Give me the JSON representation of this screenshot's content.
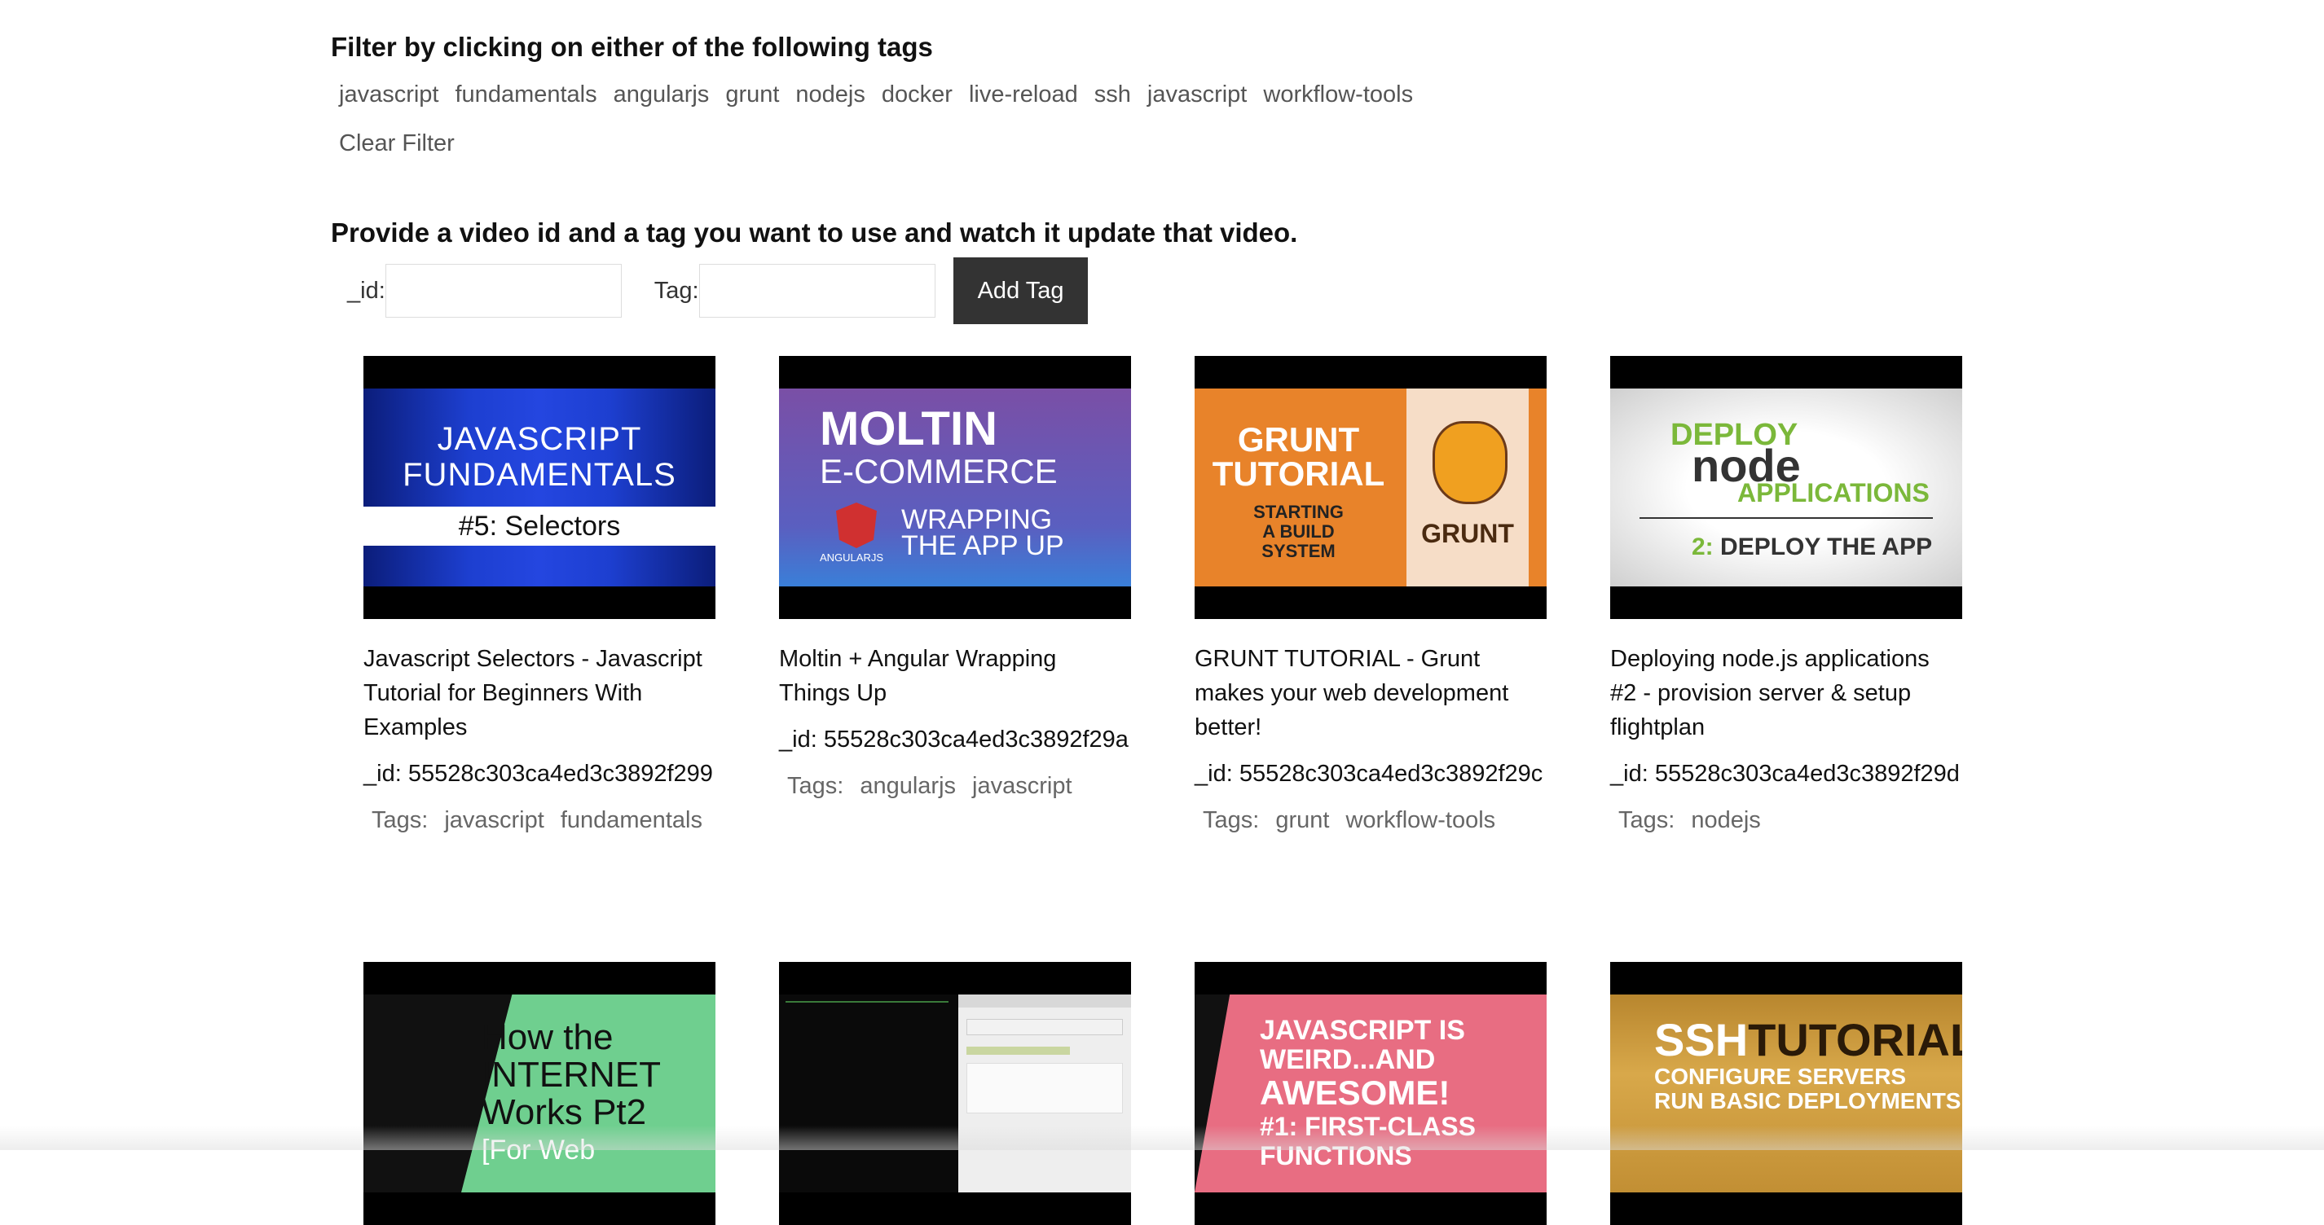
{
  "filter": {
    "heading": "Filter by clicking on either of the following tags",
    "tags": [
      "javascript",
      "fundamentals",
      "angularjs",
      "grunt",
      "nodejs",
      "docker",
      "live-reload",
      "ssh",
      "javascript",
      "workflow-tools"
    ],
    "clear_label": "Clear Filter"
  },
  "update": {
    "heading": "Provide a video id and a tag you want to use and watch it update that video.",
    "id_label": "_id:",
    "tag_label": "Tag:",
    "id_value": "",
    "tag_value": "",
    "button_label": "Add Tag"
  },
  "videos": [
    {
      "title": "Javascript Selectors - Javascript Tutorial for Beginners With Examples",
      "id_text": "_id: 55528c303ca4ed3c3892f299",
      "tags_label": "Tags:",
      "tags": [
        "javascript",
        "fundamentals"
      ],
      "thumb": {
        "line1": "JAVASCRIPT",
        "line2": "FUNDAMENTALS",
        "line3": "#5: Selectors"
      }
    },
    {
      "title": "Moltin + Angular Wrapping Things Up",
      "id_text": "_id: 55528c303ca4ed3c3892f29a",
      "tags_label": "Tags:",
      "tags": [
        "angularjs",
        "javascript"
      ],
      "thumb": {
        "line1": "MOLTIN",
        "line2": "E-COMMERCE",
        "line3": "WRAPPING",
        "line4": "THE APP UP",
        "line5": "ANGULARJS"
      }
    },
    {
      "title": "GRUNT TUTORIAL - Grunt makes your web development better!",
      "id_text": "_id: 55528c303ca4ed3c3892f29c",
      "tags_label": "Tags:",
      "tags": [
        "grunt",
        "workflow-tools"
      ],
      "thumb": {
        "line1": "GRUNT",
        "line2": "TUTORIAL",
        "line3": "STARTING",
        "line4": "A BUILD",
        "line5": "SYSTEM",
        "line6": "GRUNT"
      }
    },
    {
      "title": "Deploying node.js applications #2 - provision server & setup flightplan",
      "id_text": "_id: 55528c303ca4ed3c3892f29d",
      "tags_label": "Tags:",
      "tags": [
        "nodejs"
      ],
      "thumb": {
        "line1": "DEPLOY",
        "line2": "node",
        "line3": "APPLICATIONS",
        "line4": "2:",
        "line5": "DEPLOY THE APP"
      }
    },
    {
      "thumb": {
        "line1": "How the",
        "line2": "INTERNET",
        "line3": "Works Pt2",
        "line4": "[For Web"
      }
    },
    {
      "thumb": {}
    },
    {
      "thumb": {
        "line1": "JAVASCRIPT IS",
        "line2": "WEIRD...AND",
        "line3": "AWESOME!",
        "line4": "#1: FIRST-CLASS",
        "line5": "FUNCTIONS"
      }
    },
    {
      "thumb": {
        "line1": "SSH",
        "line2": "TUTORIAL",
        "line3": "CONFIGURE SERVERS",
        "line4": "RUN BASIC DEPLOYMENTS"
      }
    }
  ]
}
